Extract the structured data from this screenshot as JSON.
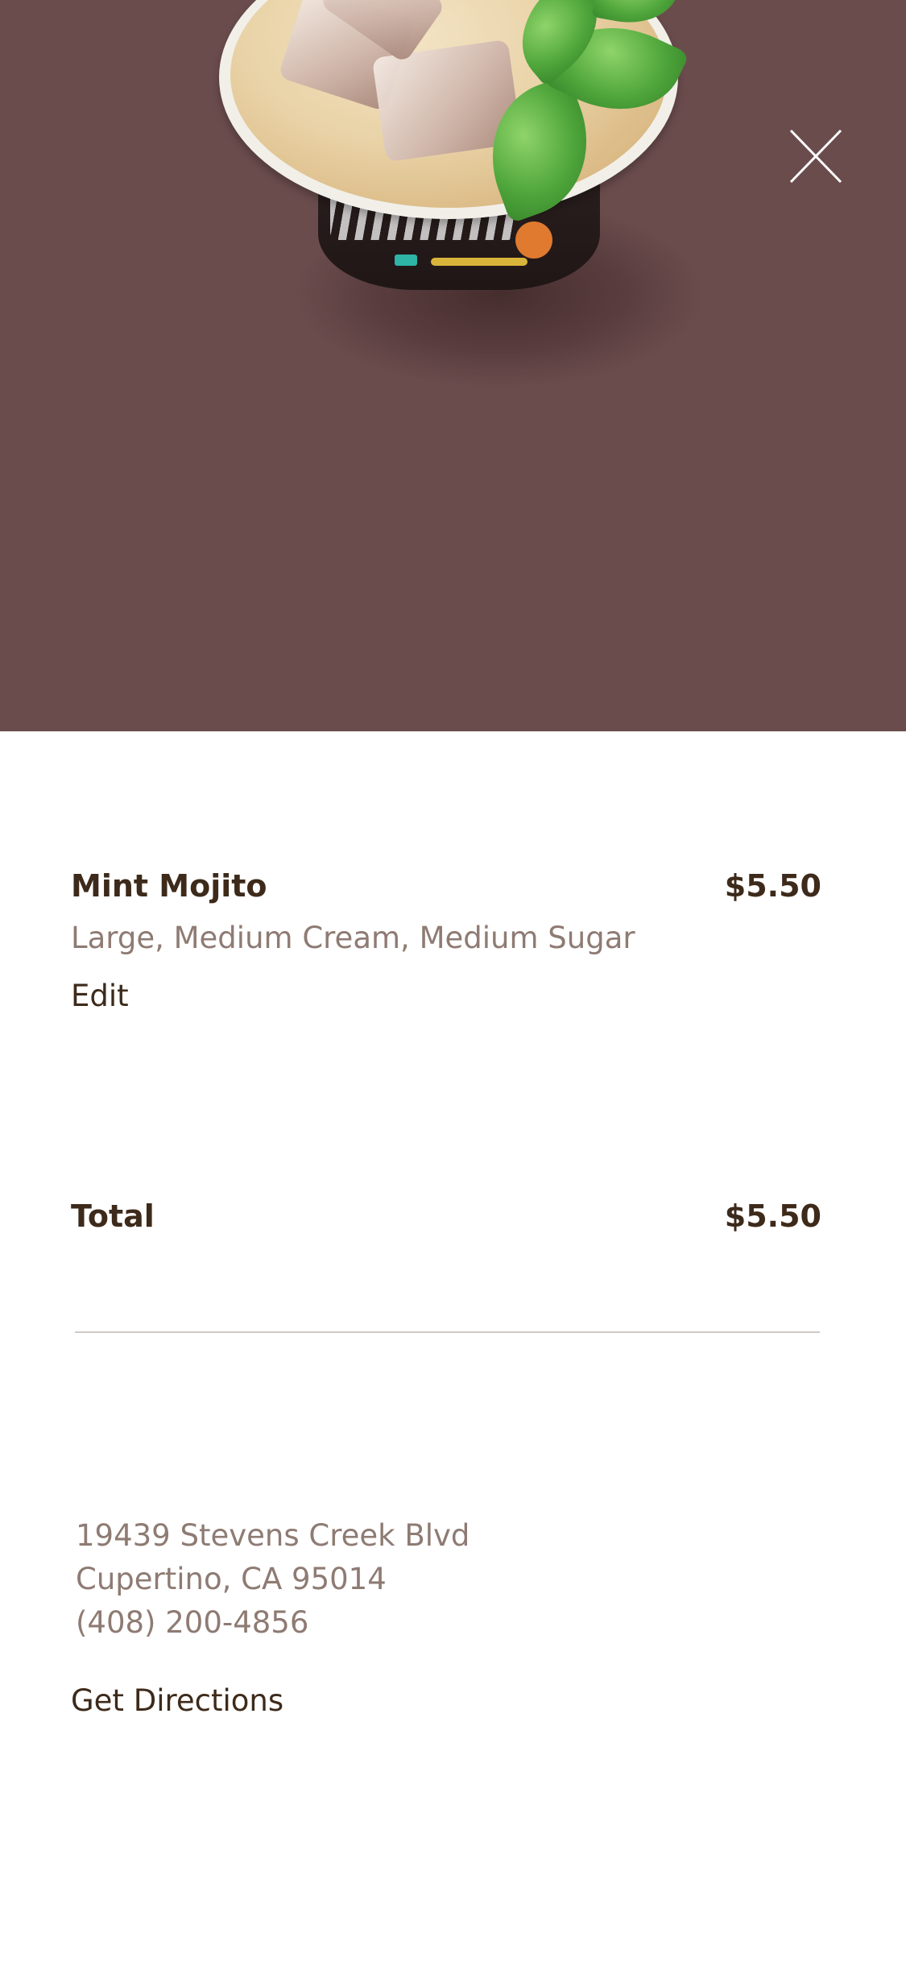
{
  "order": {
    "item": {
      "name": "Mint Mojito",
      "price": "$5.50",
      "options": "Large, Medium Cream, Medium Sugar",
      "edit_label": "Edit"
    },
    "total": {
      "label": "Total",
      "value": "$5.50"
    }
  },
  "store": {
    "address_line1": "19439 Stevens Creek Blvd",
    "address_line2": "Cupertino, CA 95014",
    "phone": "(408) 200-4856",
    "directions_label": "Get Directions"
  },
  "colors": {
    "hero_background": "#6b4c4d",
    "text_dark": "#3d2a1a",
    "text_muted": "#8e7b73",
    "divider": "#cfcac6"
  },
  "icons": {
    "close": "close-icon",
    "product": "drink-cup-image"
  }
}
